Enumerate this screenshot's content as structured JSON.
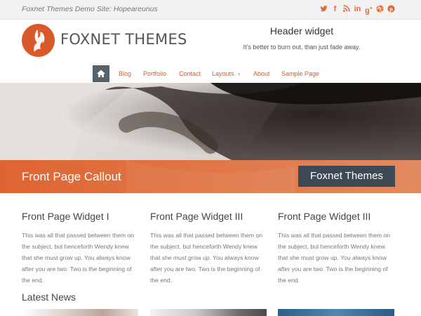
{
  "topbar": {
    "site_description": "Foxnet Themes Demo Site: Hopeareunus",
    "social_icons": [
      "twitter-icon",
      "facebook-icon",
      "rss-icon",
      "linkedin-icon",
      "google-plus-icon",
      "dribbble-icon",
      "pinterest-icon"
    ]
  },
  "header": {
    "logo_text": "FOXNET THEMES",
    "widget_title": "Header widget",
    "widget_text": "It's better to burn out, than just fade away."
  },
  "nav": {
    "home_icon": "home-icon",
    "items": [
      "Blog",
      "Portfolio",
      "Contact",
      "Layouts",
      "About",
      "Sample Page"
    ]
  },
  "callout": {
    "text": "Front Page Callout",
    "button_label": "Foxnet Themes"
  },
  "widgets": [
    {
      "title": "Front Page Widget I",
      "text": "This was all that passed between them on the subject, but henceforth Wendy knew that she must grow up. You always know after you are two. Two is the beginning of the end."
    },
    {
      "title": "Front Page Widget III",
      "text": "This was all that passed between them on the subject, but henceforth Wendy knew that she must grow up. You always know after you are two. Two is the beginning of the end."
    },
    {
      "title": "Front Page Widget III",
      "text": "This was all that passed between them on the subject, but henceforth Wendy knew that she must grow up. You always know after you are two. Two is the beginning of the end."
    }
  ],
  "latest_news": {
    "title": "Latest News"
  },
  "colors": {
    "accent": "#d9592a",
    "dark": "#3d4a55"
  }
}
